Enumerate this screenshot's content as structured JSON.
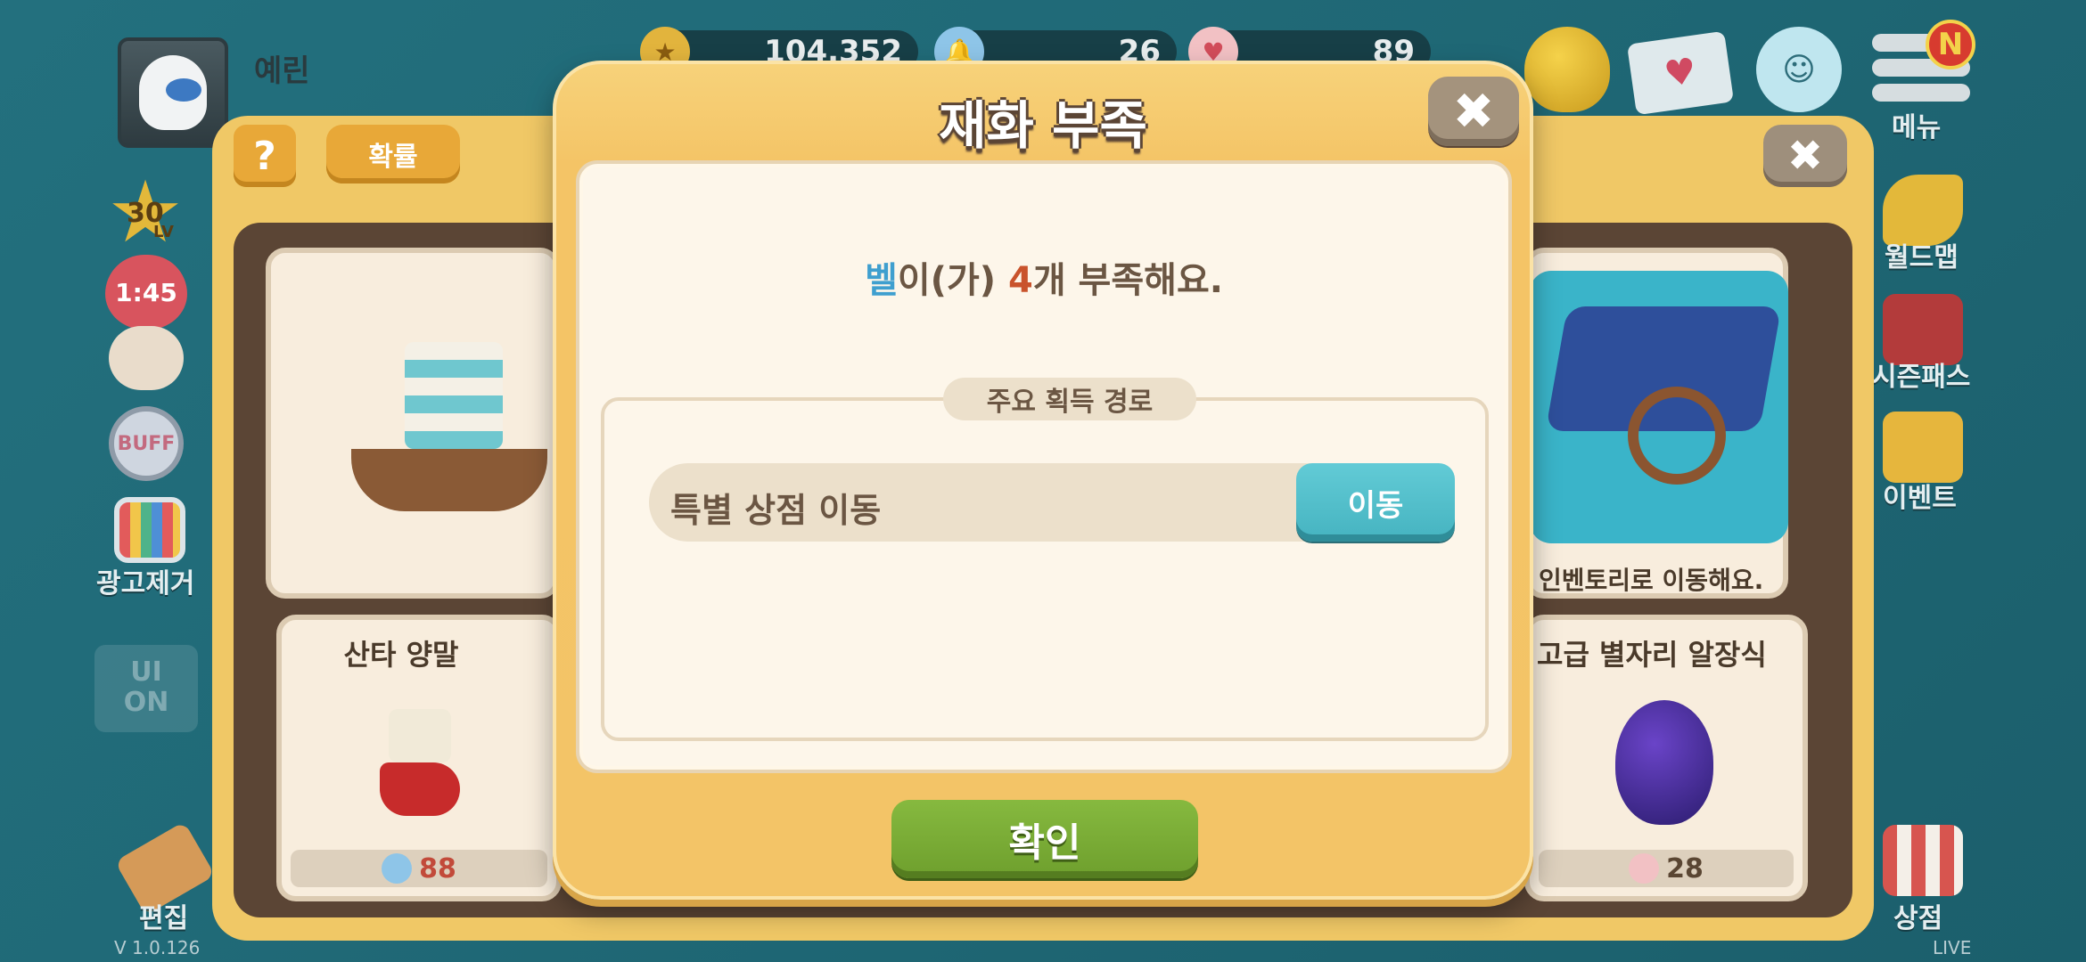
{
  "hud": {
    "player_name": "예린",
    "currencies": [
      {
        "name": "gold",
        "icon": "star-coin-icon",
        "value": "104,352"
      },
      {
        "name": "bell",
        "icon": "bell-icon",
        "value": "26"
      },
      {
        "name": "heart",
        "icon": "heart-ticket-icon",
        "value": "89"
      }
    ],
    "menu_badge": "N",
    "menu_label": "메뉴",
    "level": "30",
    "level_suffix": "LV",
    "heart_timer": "1:45",
    "buff_label": "BUFF",
    "ad_remove_label": "광고제거",
    "ui_toggle_label_1": "UI",
    "ui_toggle_label_2": "ON",
    "edit_label": "편집",
    "version": "V 1.0.126",
    "world_map_label": "월드맵",
    "season_pass_label": "시즌패스",
    "event_label": "이벤트",
    "shop_label": "상점",
    "live_label": "LIVE"
  },
  "back_panel": {
    "help_label": "?",
    "probability_label": "확률",
    "house_caption": "인벤토리로 이동해요.",
    "sock": {
      "title": "산타 양말",
      "price": "88",
      "currency_icon": "bell-icon"
    },
    "egg": {
      "title": "고급 별자리 알장식",
      "price": "28",
      "currency_icon": "heart-ticket-icon"
    }
  },
  "modal": {
    "title": "재화 부족",
    "close_label": "✖",
    "message": {
      "item": "벨",
      "part1": "이(가) ",
      "count": "4",
      "part2": "개 부족해요."
    },
    "route_header": "주요 획득 경로",
    "routes": [
      {
        "label": "특별 상점 이동",
        "button": "이동"
      }
    ],
    "confirm_label": "확인"
  },
  "colors": {
    "modal_bg": "#f4c466",
    "accent_blue": "#3f9fcf",
    "accent_red": "#c9532c",
    "move_button": "#4fbcc8",
    "confirm_button": "#78ab35",
    "backdrop": "#1f6a78"
  }
}
